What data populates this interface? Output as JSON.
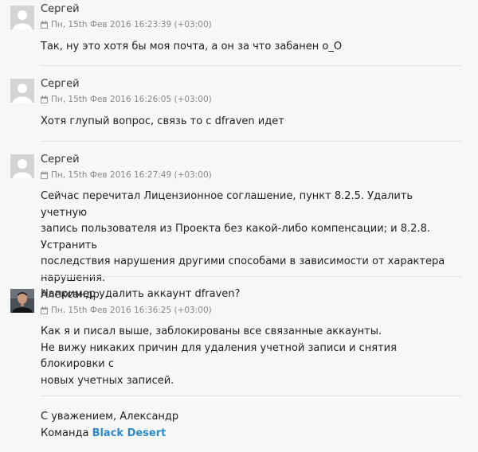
{
  "comments": [
    {
      "author": "Сергей",
      "date": "Пн, 15th Фев 2016 16:23:39 (+03:00)",
      "lines": [
        "Так, ну это хотя бы моя почта, а он за что забанен о_О"
      ]
    },
    {
      "author": "Сергей",
      "date": "Пн, 15th Фев 2016 16:26:05 (+03:00)",
      "lines": [
        "Хотя глупый вопрос, связь то с dfraven идет"
      ]
    },
    {
      "author": "Сергей",
      "date": "Пн, 15th Фев 2016 16:27:49 (+03:00)",
      "lines": [
        "Сейчас перечитал Лицензионное соглашение, пункт 8.2.5. Удалить учетную",
        "запись пользователя из Проекта без какой-либо компенсации; и 8.2.8. Устранить",
        "последствия нарушения другими способами в зависимости от характера",
        "нарушения.",
        "Например удалить аккаунт dfraven?"
      ]
    },
    {
      "author": "Александр",
      "date": "Пн, 15th Фев 2016 16:36:25 (+03:00)",
      "lines": [
        "Как я и писал выше, заблокированы все связанные аккаунты.",
        "Не вижу никаких причин для удаления учетной записи и снятия блокировки с",
        "новых учетных записей."
      ],
      "signature": {
        "regards": "С уважением, Александр",
        "team_prefix": "Команда",
        "team_link": "Black Desert"
      }
    }
  ],
  "icons": {
    "calendar": "calendar-icon",
    "default_avatar": "default-avatar-icon",
    "user_photo": "user-photo"
  },
  "colors": {
    "link": "#2b8bc9",
    "meta": "#888888",
    "background": "#f7f7f7"
  }
}
